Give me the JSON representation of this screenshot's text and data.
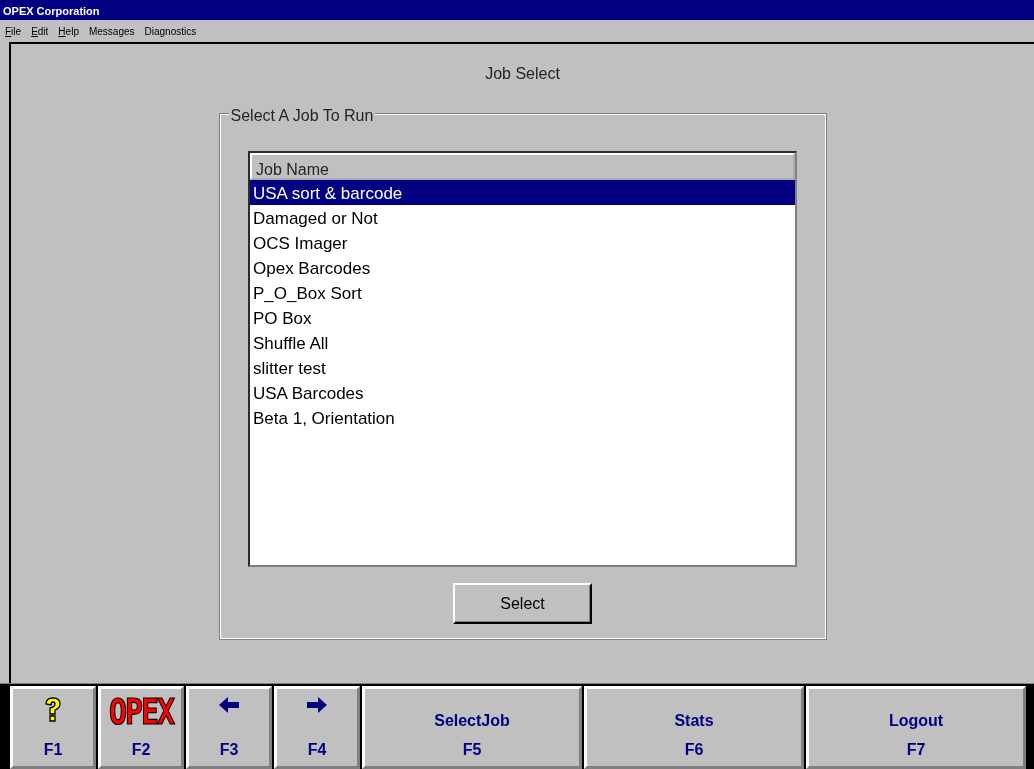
{
  "window": {
    "title": "OPEX Corporation"
  },
  "menu": [
    {
      "label": "File",
      "underline_first": true
    },
    {
      "label": "Edit",
      "underline_first": true
    },
    {
      "label": "Help",
      "underline_first": true
    },
    {
      "label": "Messages",
      "underline_first": false
    },
    {
      "label": "Diagnostics",
      "underline_first": false
    }
  ],
  "screen_title": "Job Select",
  "group": {
    "legend": "Select A Job To Run",
    "table": {
      "columns": [
        "Job Name"
      ],
      "rows": [
        {
          "name": "USA sort & barcode",
          "selected": true
        },
        {
          "name": "Damaged or Not",
          "selected": false
        },
        {
          "name": "OCS Imager",
          "selected": false
        },
        {
          "name": "Opex Barcodes",
          "selected": false
        },
        {
          "name": "P_O_Box Sort",
          "selected": false
        },
        {
          "name": "PO Box",
          "selected": false
        },
        {
          "name": "Shuffle All",
          "selected": false
        },
        {
          "name": "slitter test",
          "selected": false
        },
        {
          "name": "USA Barcodes",
          "selected": false
        },
        {
          "name": "Beta 1, Orientation",
          "selected": false
        }
      ]
    },
    "button": "Select"
  },
  "function_keys": [
    {
      "kind": "help",
      "key": "F1"
    },
    {
      "kind": "logo",
      "logo": "OPEX",
      "key": "F2"
    },
    {
      "kind": "left",
      "key": "F3"
    },
    {
      "kind": "right",
      "key": "F4"
    },
    {
      "kind": "text",
      "label": "SelectJob",
      "key": "F5"
    },
    {
      "kind": "text",
      "label": "Stats",
      "key": "F6"
    },
    {
      "kind": "text",
      "label": "Logout",
      "key": "F7"
    }
  ]
}
